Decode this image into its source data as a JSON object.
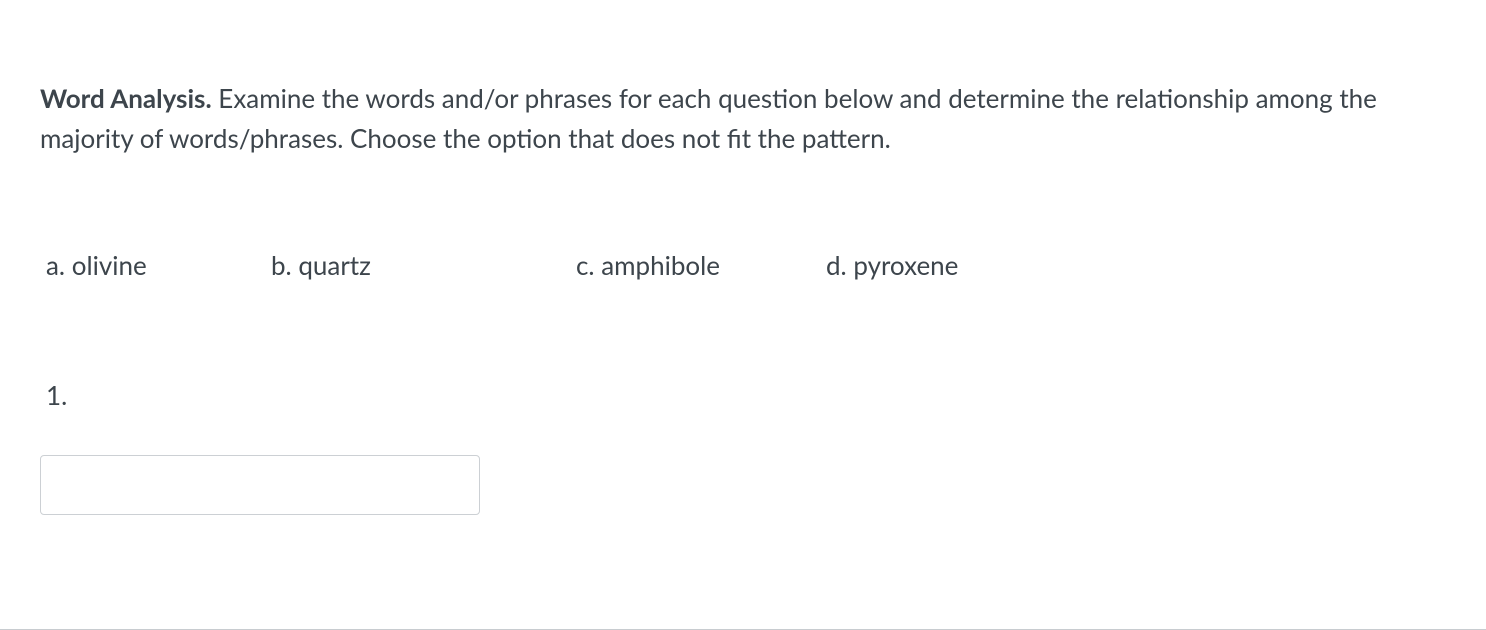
{
  "instructions": {
    "title": "Word Analysis.",
    "text": " Examine the words and/or phrases for each question below and determine the relationship among the majority of words/phrases. Choose the option that does not fit the pattern."
  },
  "options": {
    "a": "a. olivine",
    "b": "b. quartz",
    "c": "c. amphibole",
    "d": "d. pyroxene"
  },
  "question": {
    "number": "1."
  },
  "answer": {
    "value": "",
    "placeholder": ""
  }
}
